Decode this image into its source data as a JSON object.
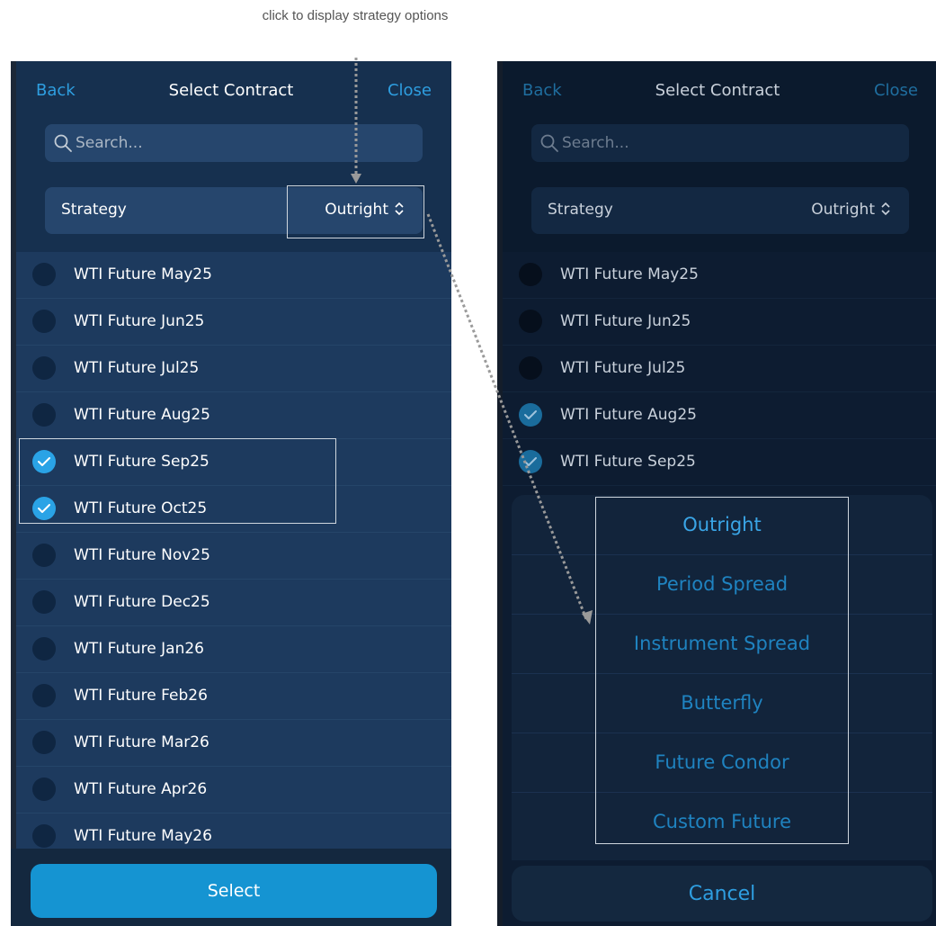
{
  "annotation": {
    "text": "click to display strategy options"
  },
  "left_screen": {
    "header": {
      "back_label": "Back",
      "title": "Select Contract",
      "close_label": "Close"
    },
    "search": {
      "placeholder": "Search..."
    },
    "strategy": {
      "label": "Strategy",
      "value": "Outright"
    },
    "contracts": [
      {
        "label": "WTI Future May25",
        "checked": false
      },
      {
        "label": "WTI Future Jun25",
        "checked": false
      },
      {
        "label": "WTI Future Jul25",
        "checked": false
      },
      {
        "label": "WTI Future Aug25",
        "checked": false
      },
      {
        "label": "WTI Future Sep25",
        "checked": true
      },
      {
        "label": "WTI Future Oct25",
        "checked": true
      },
      {
        "label": "WTI Future Nov25",
        "checked": false
      },
      {
        "label": "WTI Future Dec25",
        "checked": false
      },
      {
        "label": "WTI Future Jan26",
        "checked": false
      },
      {
        "label": "WTI Future Feb26",
        "checked": false
      },
      {
        "label": "WTI Future Mar26",
        "checked": false
      },
      {
        "label": "WTI Future Apr26",
        "checked": false
      },
      {
        "label": "WTI Future May26",
        "checked": false
      }
    ],
    "select_label": "Select"
  },
  "right_screen": {
    "header": {
      "back_label": "Back",
      "title": "Select Contract",
      "close_label": "Close"
    },
    "search": {
      "placeholder": "Search..."
    },
    "strategy": {
      "label": "Strategy",
      "value": "Outright"
    },
    "contracts": [
      {
        "label": "WTI Future May25",
        "checked": false
      },
      {
        "label": "WTI Future Jun25",
        "checked": false
      },
      {
        "label": "WTI Future Jul25",
        "checked": false
      },
      {
        "label": "WTI Future Aug25",
        "checked": true
      },
      {
        "label": "WTI Future Sep25",
        "checked": true
      }
    ],
    "strategy_options": [
      {
        "label": "Outright",
        "selected": true
      },
      {
        "label": "Period Spread",
        "selected": false
      },
      {
        "label": "Instrument Spread",
        "selected": false
      },
      {
        "label": "Butterfly",
        "selected": false
      },
      {
        "label": "Future Condor",
        "selected": false
      },
      {
        "label": "Custom Future",
        "selected": false
      }
    ],
    "cancel_label": "Cancel"
  },
  "colors": {
    "accent": "#2aa3e6",
    "primary_button": "#1594d2",
    "panel_background": "#1d3a5e",
    "dimmed_background": "#0d1c31",
    "annotation_line": "#9a9a9a"
  }
}
